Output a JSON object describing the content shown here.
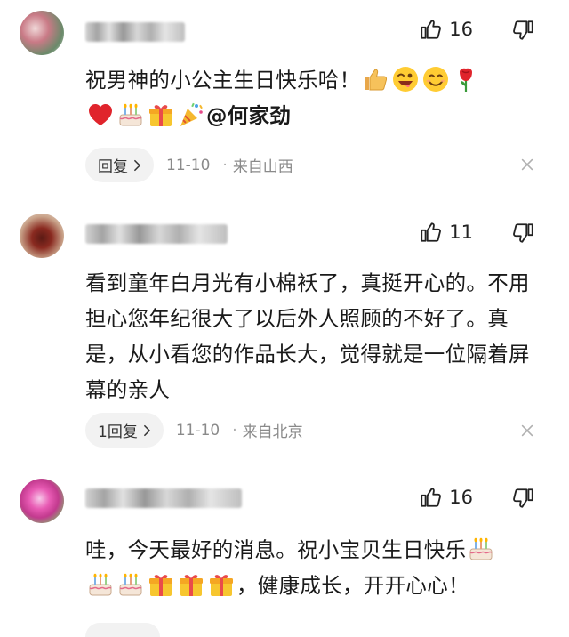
{
  "comments": [
    {
      "likes": "16",
      "text_line1": "祝男神的小公主生日快乐哈！",
      "mention": "@何家劲",
      "reply": "回复",
      "date": "11-10",
      "location": "来自山西"
    },
    {
      "likes": "11",
      "text": "看到童年白月光有小棉袄了，真挺开心的。不用担心您年纪很大了以后外人照顾的不好了。真是，从小看您的作品长大，觉得就是一位隔着屏幕的亲人",
      "reply": "1回复",
      "date": "11-10",
      "location": "来自北京"
    },
    {
      "likes": "16",
      "text_line1": "哇，今天最好的消息。祝小宝贝生日快乐",
      "text_line2": "，健康成长，开开心心！"
    }
  ],
  "colors": {
    "text": "#1a1a1a",
    "meta": "#8a8a8a",
    "pill": "#f2f2f2"
  },
  "icons": [
    "thumbs-up-icon",
    "thumbs-down-icon",
    "close-icon",
    "chevron-right-icon"
  ]
}
